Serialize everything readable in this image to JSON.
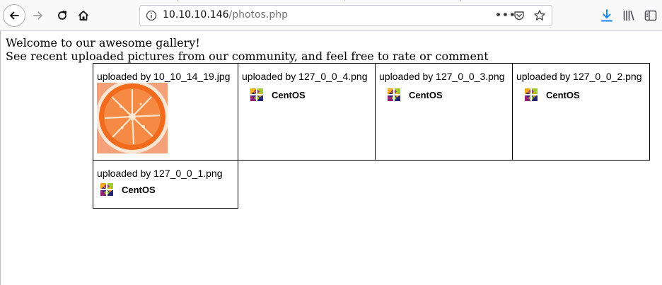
{
  "browser": {
    "url_host": "10.10.10.146",
    "url_path": "/photos.php",
    "icons": [
      "back-icon",
      "forward-icon",
      "reload-icon",
      "home-icon",
      "info-icon",
      "more-icon",
      "pocket-icon",
      "star-icon",
      "download-icon",
      "library-icon",
      "sidebar-icon"
    ]
  },
  "page": {
    "welcome_line1": "Welcome to our awesome gallery!",
    "welcome_line2": "See recent uploaded pictures from our community, and feel free to rate or comment"
  },
  "gallery": {
    "items": [
      {
        "label": "uploaded by 10_10_14_19.jpg",
        "image": "orange-slice"
      },
      {
        "label": "uploaded by 127_0_0_4.png",
        "image": "centos-logo",
        "logo_text": "CentOS"
      },
      {
        "label": "uploaded by 127_0_0_3.png",
        "image": "centos-logo",
        "logo_text": "CentOS"
      },
      {
        "label": "uploaded by 127_0_0_2.png",
        "image": "centos-logo",
        "logo_text": "CentOS"
      },
      {
        "label": "uploaded by 127_0_0_1.png",
        "image": "centos-logo",
        "logo_text": "CentOS"
      }
    ]
  },
  "colors": {
    "chrome_bg": "#f9f9fa",
    "download_accent": "#0a84ff",
    "orange": "#f26b1d"
  }
}
